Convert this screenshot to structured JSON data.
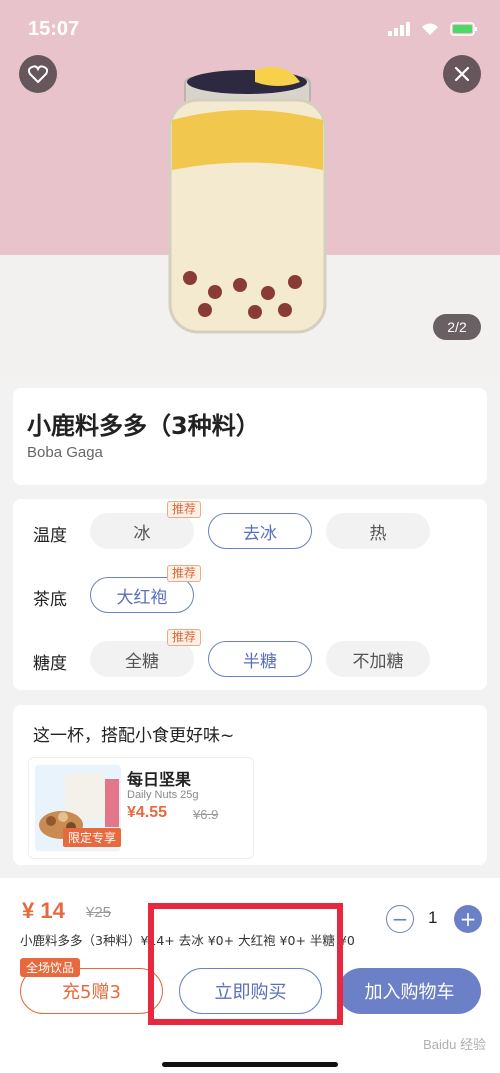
{
  "status_bar": {
    "time": "15:07"
  },
  "hero": {
    "page_indicator": "2/2"
  },
  "product": {
    "title": "小鹿料多多（3种料）",
    "subtitle": "Boba Gaga"
  },
  "options": {
    "temperature": {
      "label": "温度",
      "choices": [
        "冰",
        "去冰",
        "热"
      ],
      "selected": "去冰",
      "badge": "推荐"
    },
    "tea_base": {
      "label": "茶底",
      "choices": [
        "大红袍"
      ],
      "selected": "大红袍",
      "badge": "推荐"
    },
    "sugar": {
      "label": "糖度",
      "choices": [
        "全糖",
        "半糖",
        "不加糖"
      ],
      "selected": "半糖",
      "badge": "推荐"
    }
  },
  "snacks": {
    "heading": "这一杯，搭配小食更好味~",
    "item": {
      "name": "每日坚果",
      "desc": "Daily Nuts 25g",
      "price": "¥4.55",
      "old_price": "¥6.9",
      "tag": "限定专享"
    }
  },
  "bottom": {
    "price": "¥ 14",
    "old_price": "¥25",
    "quantity": "1",
    "summary": "小鹿料多多（3种料）¥14+ 去冰 ¥0+ 大红袍 ¥0+ 半糖 ¥0",
    "promo_badge": "全场饮品",
    "recharge_label": "充5赠3",
    "buy_now_label": "立即购买",
    "add_cart_label": "加入购物车"
  },
  "watermark": "Baidu 经验",
  "colors": {
    "accent_blue": "#6c80c7",
    "accent_orange": "#e66a3d",
    "highlight_red": "#e8283f"
  }
}
